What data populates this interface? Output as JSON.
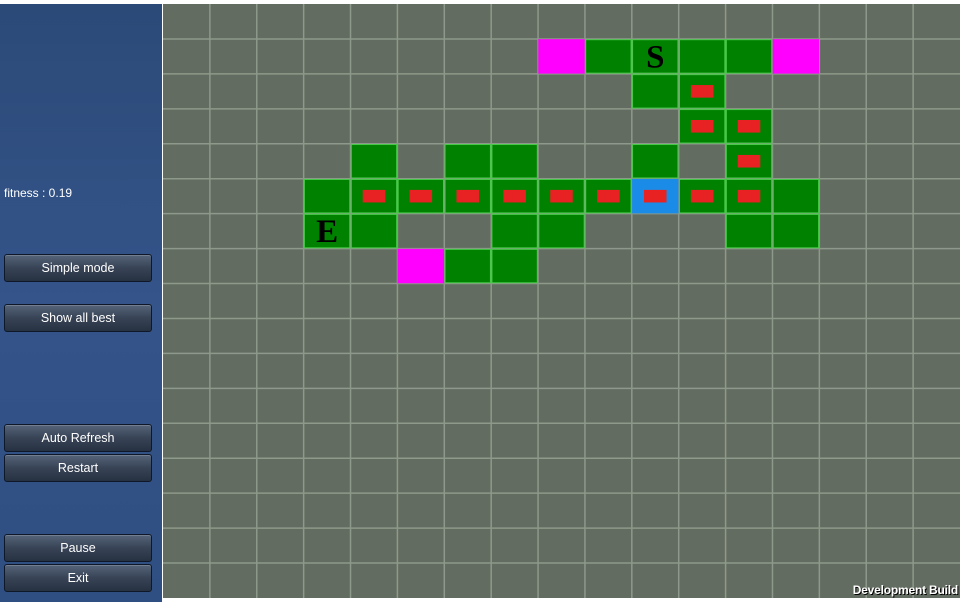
{
  "sidebar": {
    "fitness_text": "fitness : 0.19",
    "buttons": {
      "simple_mode": "Simple mode",
      "show_all_best": "Show all best",
      "auto_refresh": "Auto Refresh",
      "restart": "Restart",
      "pause": "Pause",
      "exit": "Exit"
    }
  },
  "grid": {
    "cols": 17,
    "rows": 17,
    "colors": {
      "empty": "#636c60",
      "line": "#8d998a",
      "path": "#008200",
      "path_line": "#4ac94a",
      "room": "#ff00ff",
      "current": "#1a8ce8",
      "marker": "#e82222"
    },
    "start": {
      "label": "S",
      "col": 10,
      "row": 1
    },
    "end": {
      "label": "E",
      "col": 3,
      "row": 6
    },
    "green_cells": [
      [
        9,
        1
      ],
      [
        11,
        1
      ],
      [
        12,
        1
      ],
      [
        10,
        2
      ],
      [
        11,
        2
      ],
      [
        11,
        3
      ],
      [
        12,
        3
      ],
      [
        4,
        4
      ],
      [
        6,
        4
      ],
      [
        7,
        4
      ],
      [
        10,
        4
      ],
      [
        12,
        4
      ],
      [
        3,
        5
      ],
      [
        4,
        5
      ],
      [
        5,
        5
      ],
      [
        6,
        5
      ],
      [
        7,
        5
      ],
      [
        8,
        5
      ],
      [
        9,
        5
      ],
      [
        11,
        5
      ],
      [
        12,
        5
      ],
      [
        13,
        5
      ],
      [
        4,
        6
      ],
      [
        7,
        6
      ],
      [
        8,
        6
      ],
      [
        12,
        6
      ],
      [
        13,
        6
      ],
      [
        6,
        7
      ],
      [
        7,
        7
      ]
    ],
    "room_cells": [
      [
        8,
        1
      ],
      [
        13,
        1
      ],
      [
        5,
        7
      ]
    ],
    "current_cell": [
      10,
      5
    ],
    "marker_cells": [
      [
        11,
        2
      ],
      [
        11,
        3
      ],
      [
        12,
        3
      ],
      [
        12,
        4
      ],
      [
        4,
        5
      ],
      [
        5,
        5
      ],
      [
        6,
        5
      ],
      [
        7,
        5
      ],
      [
        8,
        5
      ],
      [
        9,
        5
      ],
      [
        10,
        5
      ],
      [
        11,
        5
      ],
      [
        12,
        5
      ]
    ]
  },
  "footer": {
    "build_label": "Development Build"
  }
}
